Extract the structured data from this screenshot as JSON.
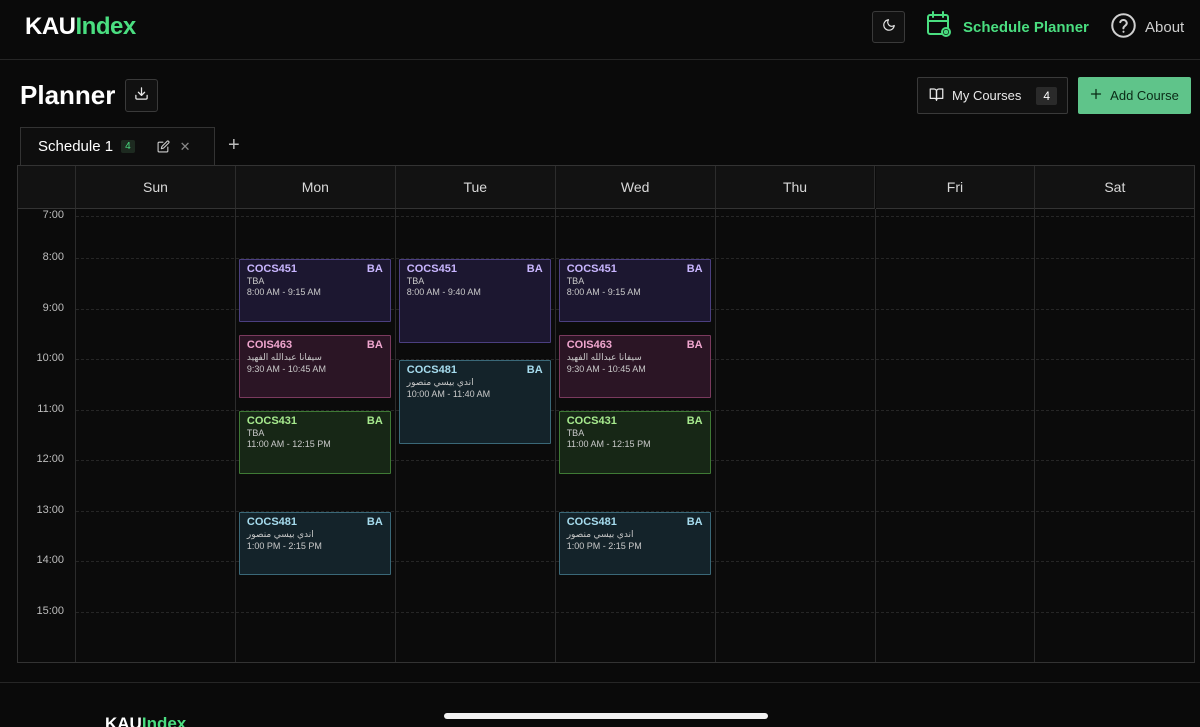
{
  "nav": {
    "logo_part1": "KAU",
    "logo_part2": "Index",
    "planner_label": "Schedule Planner",
    "about_label": "About"
  },
  "header": {
    "title": "Planner",
    "my_courses_label": "My Courses",
    "my_courses_count": "4",
    "add_course_label": "Add Course"
  },
  "tabs": [
    {
      "label": "Schedule 1",
      "count": "4"
    }
  ],
  "calendar": {
    "days": [
      "Sun",
      "Mon",
      "Tue",
      "Wed",
      "Thu",
      "Fri",
      "Sat"
    ],
    "times": [
      "7:00",
      "8:00",
      "9:00",
      "10:00",
      "11:00",
      "12:00",
      "13:00",
      "14:00",
      "15:00"
    ]
  },
  "events": [
    {
      "code": "COCS451",
      "section": "BA",
      "instructor": "TBA",
      "time": "8:00 AM - 9:15 AM",
      "color": "purple"
    },
    {
      "code": "COIS463",
      "section": "BA",
      "instructor": "سيفانا عبدالله الفهيد",
      "time": "9:30 AM - 10:45 AM",
      "color": "pink"
    },
    {
      "code": "COCS431",
      "section": "BA",
      "instructor": "TBA",
      "time": "11:00 AM - 12:15 PM",
      "color": "green"
    },
    {
      "code": "COCS481",
      "section": "BA",
      "instructor": "اندي بيسي منصور",
      "time": "1:00 PM - 2:15 PM",
      "color": "teal"
    },
    {
      "code": "COCS451",
      "section": "BA",
      "instructor": "TBA",
      "time": "8:00 AM - 9:40 AM",
      "color": "purple"
    },
    {
      "code": "COCS481",
      "section": "BA",
      "instructor": "اندي بيسي منصور",
      "time": "10:00 AM - 11:40 AM",
      "color": "teal"
    },
    {
      "code": "COCS451",
      "section": "BA",
      "instructor": "TBA",
      "time": "8:00 AM - 9:15 AM",
      "color": "purple"
    },
    {
      "code": "COIS463",
      "section": "BA",
      "instructor": "سيفانا عبدالله الفهيد",
      "time": "9:30 AM - 10:45 AM",
      "color": "pink"
    },
    {
      "code": "COCS431",
      "section": "BA",
      "instructor": "TBA",
      "time": "11:00 AM - 12:15 PM",
      "color": "green"
    },
    {
      "code": "COCS481",
      "section": "BA",
      "instructor": "اندي بيسي منصور",
      "time": "1:00 PM - 2:15 PM",
      "color": "teal"
    }
  ],
  "footer": {
    "logo_part1": "KAU",
    "logo_part2": "Index"
  }
}
